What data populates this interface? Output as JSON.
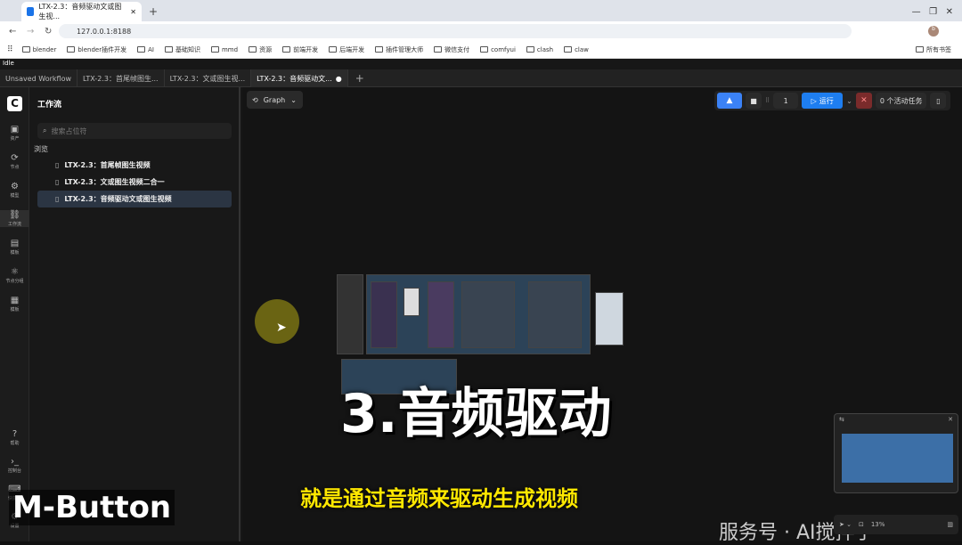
{
  "browser": {
    "tab_title": "LTX-2.3：音频驱动文或图生视...",
    "url": "127.0.0.1:8188",
    "bookmarks": [
      "blender",
      "blender插件开发",
      "AI",
      "基础知识",
      "mmd",
      "资源",
      "前端开发",
      "后端开发",
      "插件管理大师",
      "微信支付",
      "comfyui",
      "clash",
      "claw"
    ],
    "bookmarks_right": "所有书签"
  },
  "app": {
    "status": "Idle",
    "workflow_tabs": [
      "Unsaved Workflow",
      "LTX-2.3：首尾帧图生...",
      "LTX-2.3：文或图生视...",
      "LTX-2.3：音频驱动文..."
    ],
    "sidebar": [
      {
        "label": "资产",
        "icon": "image-icon"
      },
      {
        "label": "节点",
        "icon": "node-icon"
      },
      {
        "label": "模型",
        "icon": "model-icon"
      },
      {
        "label": "工作流",
        "icon": "workflow-icon"
      },
      {
        "label": "模板",
        "icon": "template-icon"
      },
      {
        "label": "节点分组",
        "icon": "group-icon"
      },
      {
        "label": "模板",
        "icon": "layout-icon"
      }
    ],
    "sidebar_bottom": [
      {
        "label": "帮助",
        "icon": "help-icon"
      },
      {
        "label": "控制台",
        "icon": "console-icon"
      },
      {
        "label": "快捷键",
        "icon": "keyboard-icon"
      },
      {
        "label": "设置",
        "icon": "settings-icon"
      }
    ],
    "panel": {
      "title": "工作流",
      "search_placeholder": "搜索占位符",
      "browse_label": "浏览",
      "items": [
        "LTX-2.3：首尾帧图生视频",
        "LTX-2.3：文或图生视频二合一",
        "LTX-2.3：音频驱动文或图生视频"
      ]
    },
    "toolbar": {
      "graph_label": "Graph",
      "count": "1",
      "run_label": "运行",
      "queue_label": "0 个活动任务"
    },
    "zoom": "13%",
    "overlay": {
      "heading": "3.音频驱动",
      "subtitle": "就是通过音频来驱动生成视频",
      "watermark": "服务号 · AI搅拌手",
      "key_label": "M-Button"
    }
  }
}
